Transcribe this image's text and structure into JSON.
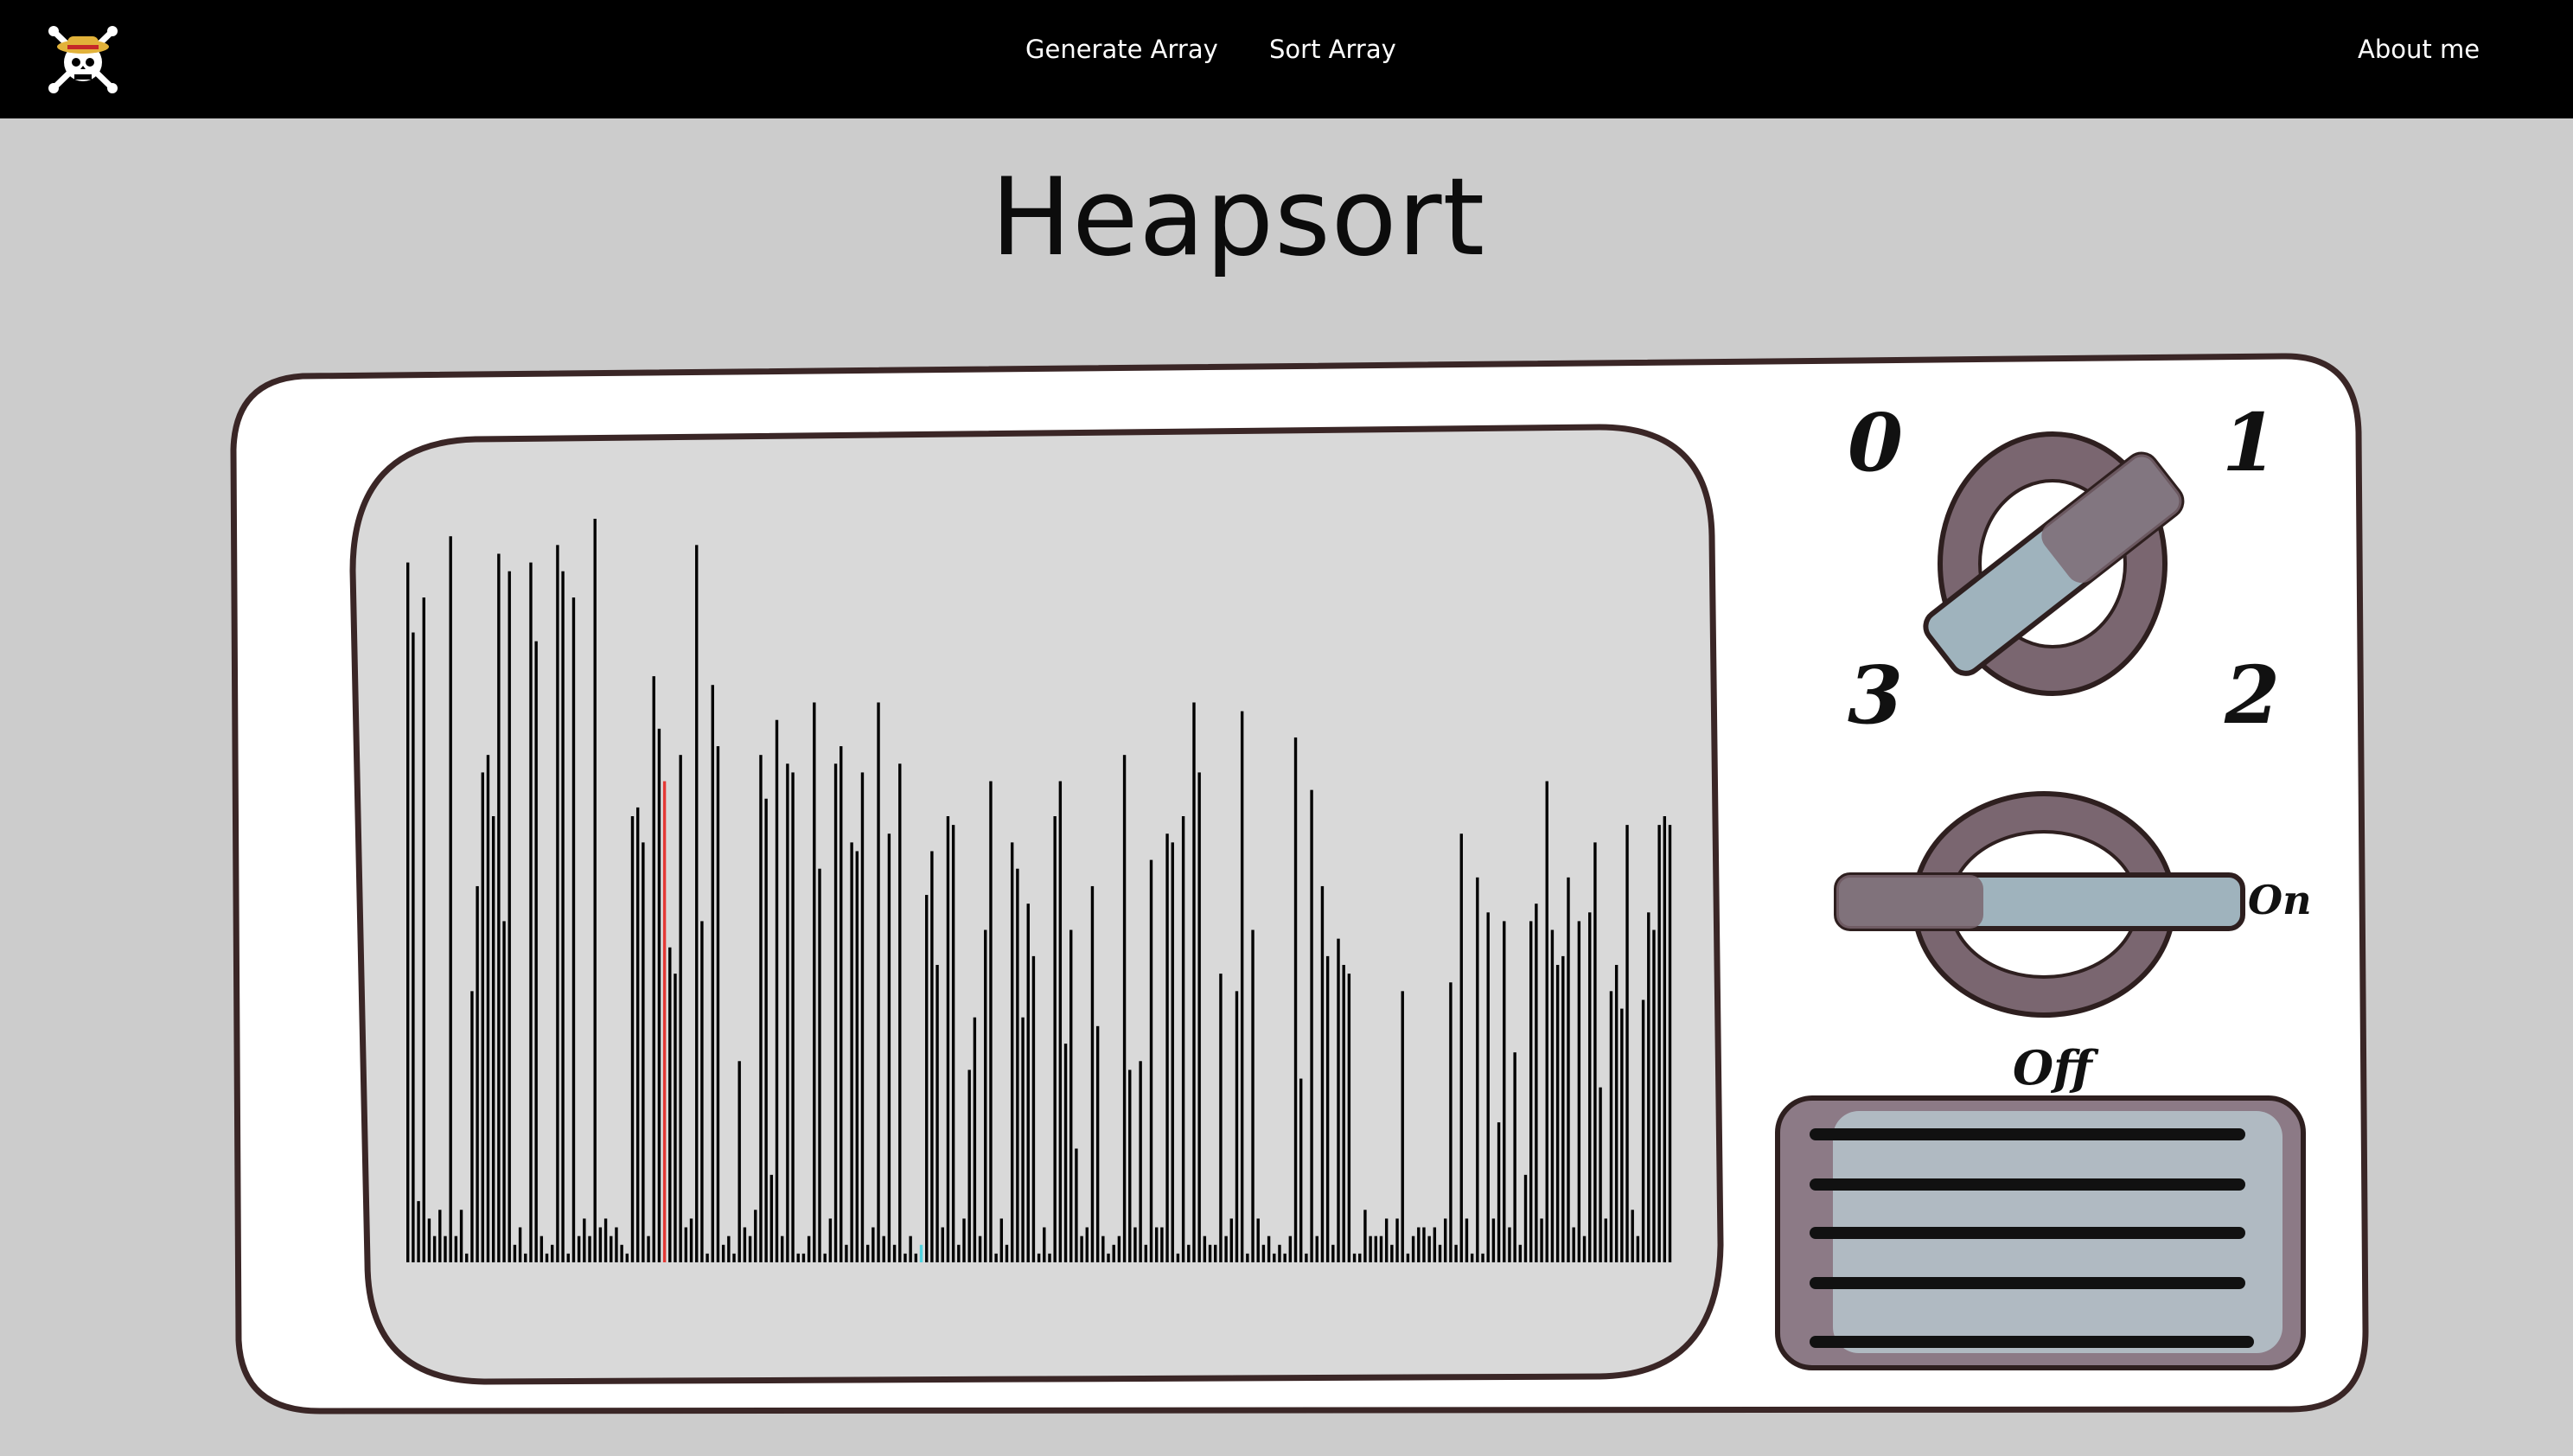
{
  "nav": {
    "logo": "straw-hat-skull-icon",
    "links": [
      "Generate Array",
      "Sort Array"
    ],
    "about": "About me"
  },
  "title": "Heapsort",
  "tv": {
    "dial_labels": [
      "0",
      "1",
      "3",
      "2"
    ],
    "switch_on": "On",
    "switch_off": "Off"
  },
  "colors": {
    "background": "#cccccc",
    "navbar": "#000000",
    "bar": "#000000",
    "bar_compare": "#e53935",
    "bar_swap": "#4fd3e0",
    "tv_body": "#ffffff",
    "tv_outline": "#3a2626",
    "screen": "#d9d9d9",
    "knob": "#7a6670",
    "knob_handle": "#9fb3bd"
  },
  "array": {
    "values": [
      80,
      72,
      7,
      76,
      5,
      3,
      6,
      3,
      83,
      3,
      6,
      1,
      31,
      43,
      56,
      58,
      51,
      81,
      39,
      79,
      2,
      4,
      1,
      80,
      71,
      3,
      1,
      2,
      82,
      79,
      1,
      76,
      3,
      5,
      3,
      85,
      4,
      5,
      3,
      4,
      2,
      1,
      51,
      52,
      48,
      3,
      67,
      61,
      55,
      36,
      33,
      58,
      4,
      5,
      82,
      39,
      1,
      66,
      59,
      2,
      3,
      1,
      23,
      4,
      3,
      6,
      58,
      53,
      10,
      62,
      3,
      57,
      56,
      1,
      1,
      3,
      64,
      45,
      1,
      5,
      57,
      59,
      2,
      48,
      47,
      56,
      2,
      4,
      64,
      3,
      49,
      2,
      57,
      1,
      3,
      1,
      2,
      42,
      47,
      34,
      4,
      51,
      50,
      2,
      5,
      22,
      28,
      3,
      38,
      55,
      1,
      5,
      2,
      48,
      45,
      28,
      41,
      35,
      1,
      4,
      1,
      51,
      55,
      25,
      38,
      13,
      3,
      4,
      43,
      27,
      3,
      1,
      2,
      3,
      58,
      22,
      4,
      23,
      2,
      46,
      4,
      4,
      49,
      48,
      1,
      51,
      2,
      64,
      56,
      3,
      2,
      2,
      33,
      3,
      5,
      31,
      63,
      1,
      38,
      5,
      2,
      3,
      1,
      2,
      1,
      3,
      60,
      21,
      1,
      54,
      3,
      43,
      35,
      2,
      37,
      34,
      33,
      1,
      1,
      6,
      3,
      3,
      3,
      5,
      2,
      5,
      31,
      1,
      3,
      4,
      4,
      3,
      4,
      2,
      5,
      32,
      2,
      49,
      5,
      1,
      44,
      1,
      40,
      5,
      16,
      39,
      4,
      24,
      2,
      10,
      39,
      41,
      5,
      55,
      38,
      34,
      35,
      44,
      4,
      39,
      3,
      40,
      48,
      20,
      5,
      31,
      34,
      29,
      50,
      6,
      3,
      30,
      40,
      38,
      50,
      51,
      50
    ],
    "max": 85,
    "compare_index": 48,
    "swap_index": 96
  }
}
